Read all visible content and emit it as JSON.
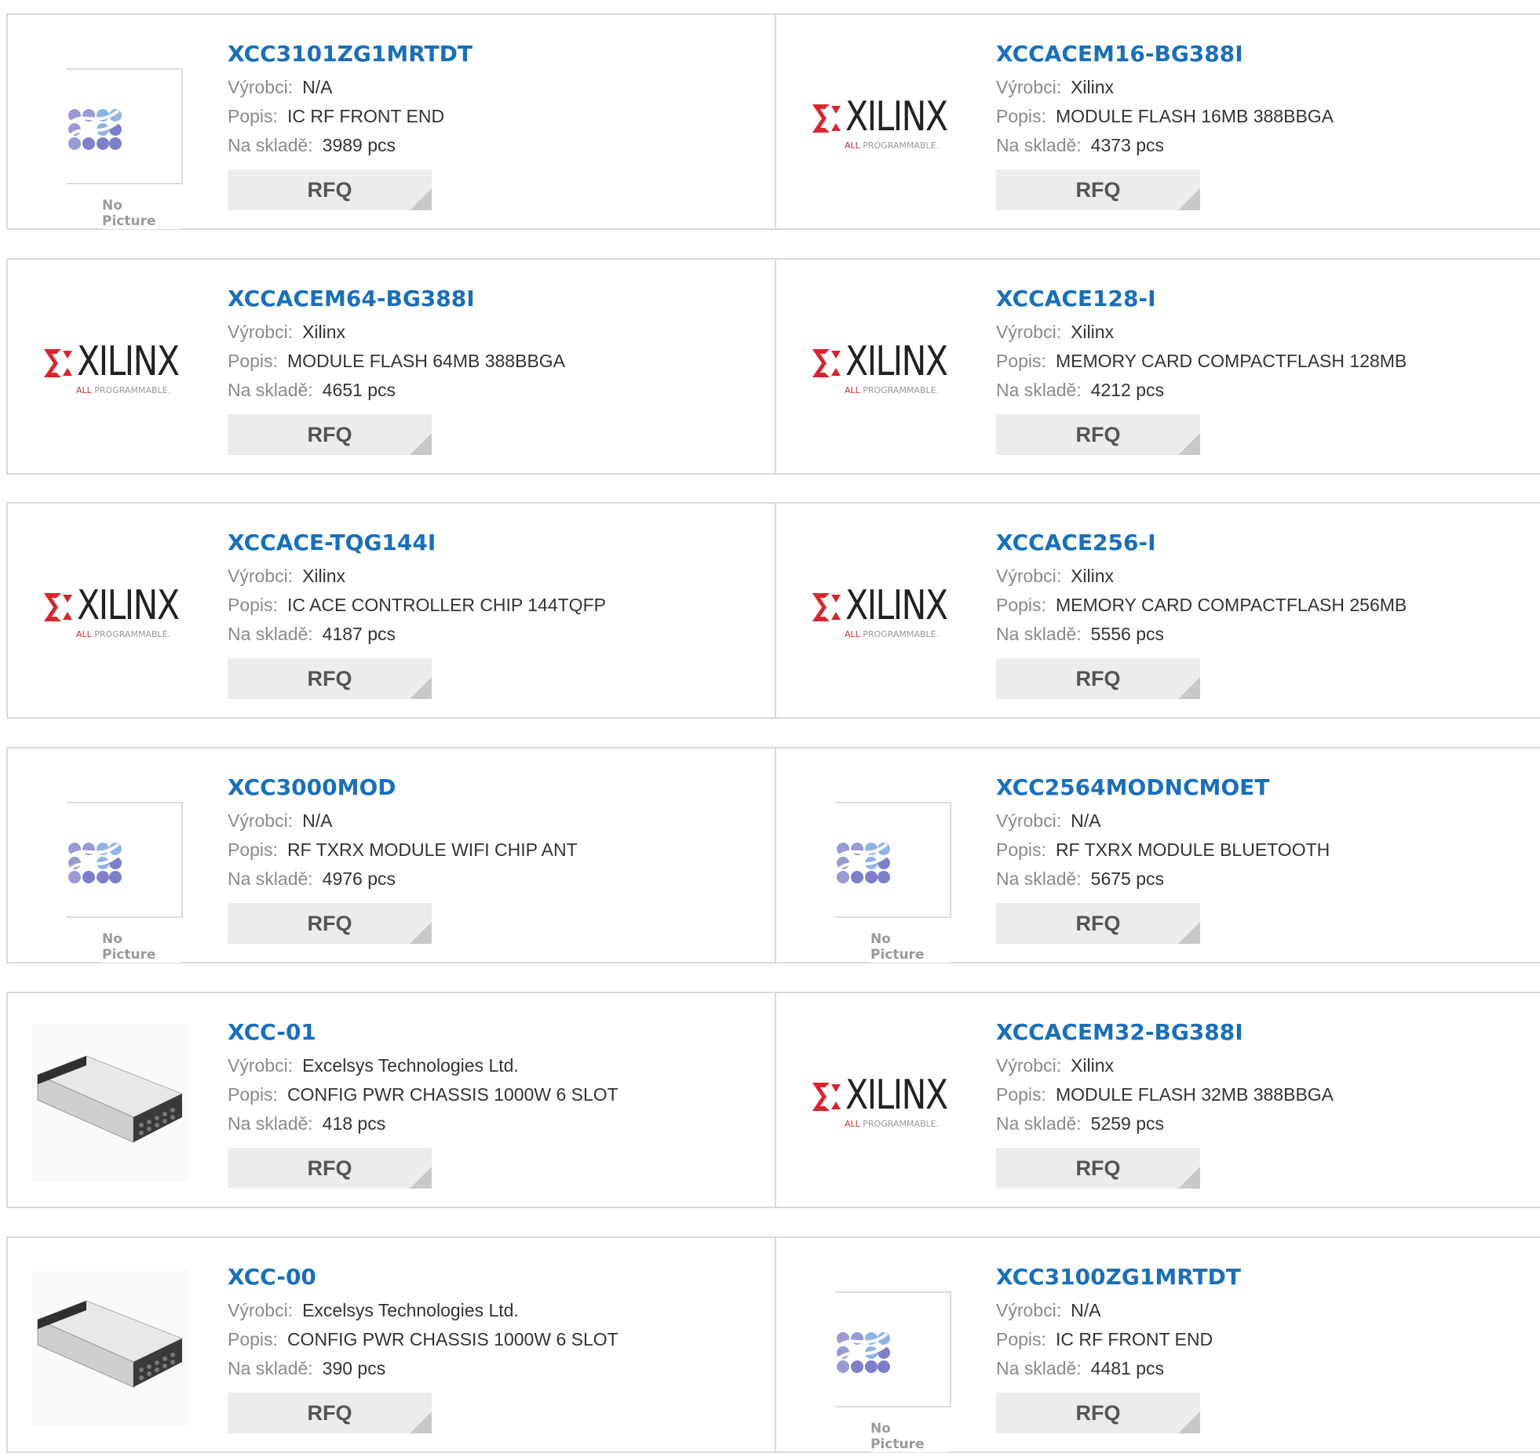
{
  "labels": {
    "manufacturer": "Výrobci:",
    "description": "Popis:",
    "stock": "Na skladě:",
    "rfq": "RFQ",
    "no_picture": "No Picture",
    "xilinx_word": "XILINX",
    "xilinx_tag_a": "ALL ",
    "xilinx_tag_b": "PROGRAMMABLE."
  },
  "products": [
    {
      "part": "XCC3101ZG1MRTDT",
      "manufacturer": "N/A",
      "description": "IC RF FRONT END",
      "stock": "3989 pcs",
      "image": "no-picture"
    },
    {
      "part": "XCCACEM16-BG388I",
      "manufacturer": "Xilinx",
      "description": "MODULE FLASH 16MB 388BBGA",
      "stock": "4373 pcs",
      "image": "xilinx-logo"
    },
    {
      "part": "XCCACEM64-BG388I",
      "manufacturer": "Xilinx",
      "description": "MODULE FLASH 64MB 388BBGA",
      "stock": "4651 pcs",
      "image": "xilinx-logo"
    },
    {
      "part": "XCCACE128-I",
      "manufacturer": "Xilinx",
      "description": "MEMORY CARD COMPACTFLASH 128MB",
      "stock": "4212 pcs",
      "image": "xilinx-logo"
    },
    {
      "part": "XCCACE-TQG144I",
      "manufacturer": "Xilinx",
      "description": "IC ACE CONTROLLER CHIP 144TQFP",
      "stock": "4187 pcs",
      "image": "xilinx-logo"
    },
    {
      "part": "XCCACE256-I",
      "manufacturer": "Xilinx",
      "description": "MEMORY CARD COMPACTFLASH 256MB",
      "stock": "5556 pcs",
      "image": "xilinx-logo"
    },
    {
      "part": "XCC3000MOD",
      "manufacturer": "N/A",
      "description": "RF TXRX MODULE WIFI CHIP ANT",
      "stock": "4976 pcs",
      "image": "no-picture"
    },
    {
      "part": "XCC2564MODNCMOET",
      "manufacturer": "N/A",
      "description": "RF TXRX MODULE BLUETOOTH",
      "stock": "5675 pcs",
      "image": "no-picture"
    },
    {
      "part": "XCC-01",
      "manufacturer": "Excelsys Technologies Ltd.",
      "description": "CONFIG PWR CHASSIS 1000W 6 SLOT",
      "stock": "418 pcs",
      "image": "chassis-photo"
    },
    {
      "part": "XCCACEM32-BG388I",
      "manufacturer": "Xilinx",
      "description": "MODULE FLASH 32MB 388BBGA",
      "stock": "5259 pcs",
      "image": "xilinx-logo"
    },
    {
      "part": "XCC-00",
      "manufacturer": "Excelsys Technologies Ltd.",
      "description": "CONFIG PWR CHASSIS 1000W 6 SLOT",
      "stock": "390 pcs",
      "image": "chassis-photo"
    },
    {
      "part": "XCC3100ZG1MRTDT",
      "manufacturer": "N/A",
      "description": "IC RF FRONT END",
      "stock": "4481 pcs",
      "image": "no-picture"
    }
  ],
  "colors": {
    "part_link": "#1a6fb8",
    "label_gray": "#8a8a8a",
    "border": "#d9d9d9",
    "rfq_bg": "#ececec",
    "xilinx_red": "#c83232"
  }
}
